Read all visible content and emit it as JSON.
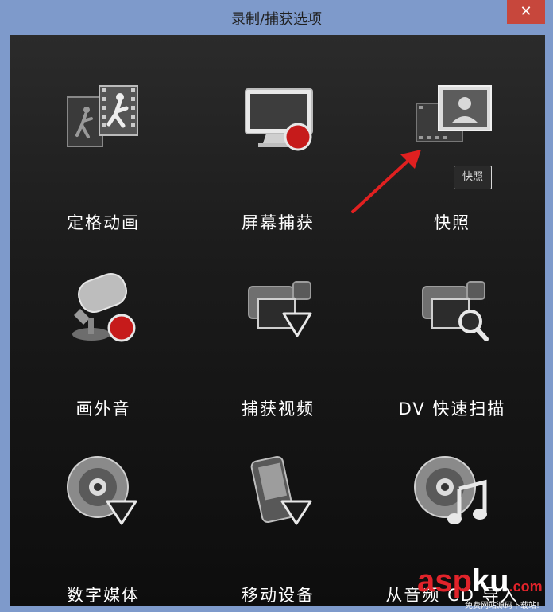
{
  "window": {
    "title": "录制/捕获选项",
    "close_symbol": "✕"
  },
  "options": [
    {
      "label": "定格动画",
      "icon": "stop-motion-icon"
    },
    {
      "label": "屏幕捕获",
      "icon": "screen-capture-icon"
    },
    {
      "label": "快照",
      "icon": "snapshot-icon"
    },
    {
      "label": "画外音",
      "icon": "voiceover-icon"
    },
    {
      "label": "捕获视频",
      "icon": "capture-video-icon"
    },
    {
      "label": "DV 快速扫描",
      "icon": "dv-quick-scan-icon"
    },
    {
      "label": "数字媒体",
      "icon": "digital-media-icon"
    },
    {
      "label": "移动设备",
      "icon": "mobile-device-icon"
    },
    {
      "label": "从音频 CD 导入",
      "icon": "audio-cd-import-icon"
    }
  ],
  "tooltip": {
    "text": "快照"
  },
  "watermark": {
    "main_a": "asp",
    "main_k": "ku",
    "com": ".com",
    "sub": "免费网站源码下载站!"
  },
  "colors": {
    "titlebar": "#7e9acb",
    "close": "#c7473c",
    "panel": "#1b1b1b",
    "record_red": "#c61b1b",
    "arrow": "#e02020"
  }
}
